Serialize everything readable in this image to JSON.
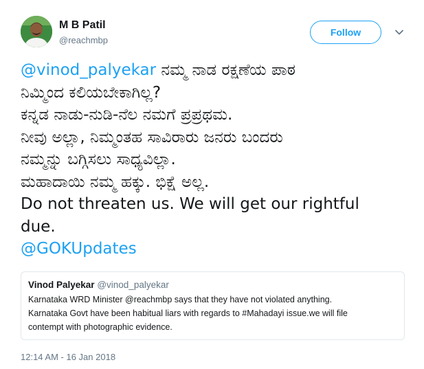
{
  "author": {
    "name": "M B Patil",
    "handle": "@reachmbp"
  },
  "follow_label": "Follow",
  "tweet": {
    "mention_lead": "@vinod_palyekar",
    "line1_rest": " ನಮ್ಮ ನಾಡ ರಕ್ಷಣೆಯ ಪಾಠ",
    "line2": "ನಿಮ್ಮಿಂದ ಕಲಿಯಬೇಕಾಗಿಲ್ಲ?",
    "line3": "ಕನ್ನಡ ನಾಡು-ನುಡಿ-ನೆಲ ನಮಗೆ ಪ್ರಪ್ರಥಮ.",
    "line4": "ನೀವು ಅಲ್ಲಾ, ನಿಮ್ಮಂತಹ ಸಾವಿರಾರು ಜನರು ಬಂದರು",
    "line5": "ನಮ್ಮನ್ನು ಬಗ್ಗಿಸಲು ಸಾಧ್ಯವಿಲ್ಲಾ.",
    "line6": "ಮಹಾದಾಯಿ ನಮ್ಮ ಹಕ್ಕು. ಭಿಕ್ಷೆ ಅಲ್ಲ.",
    "line7": "Do not threaten us. We will get our rightful",
    "line8": "due.",
    "mention_tail": "@GOKUpdates"
  },
  "quoted_tweet": {
    "name": "Vinod Palyekar",
    "handle": "@vinod_palyekar",
    "text": "Karnataka WRD Minister @reachmbp  says that they have not violated anything.\nKarnataka Govt have been habitual liars with regards to #Mahadayi issue.we will file\ncontempt with photographic evidence."
  },
  "timestamp": "12:14 AM - 16 Jan 2018",
  "colors": {
    "accent": "#1da1f2",
    "muted": "#657786",
    "text": "#14171a",
    "border": "#e1e8ed"
  },
  "icons": {
    "more": "chevron-down-icon"
  }
}
